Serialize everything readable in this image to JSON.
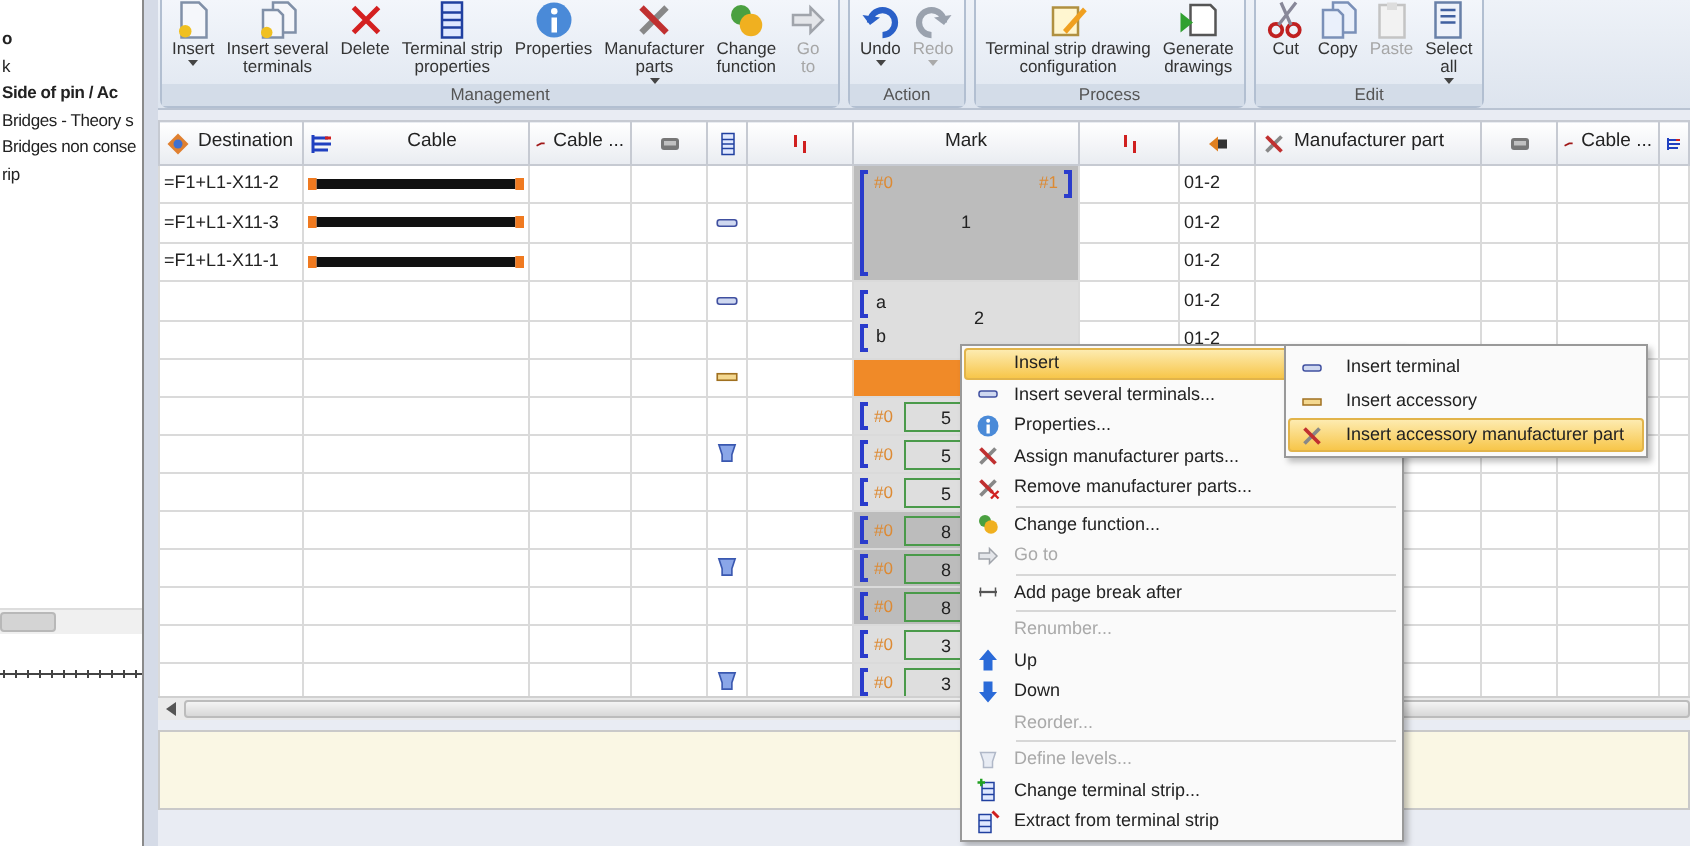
{
  "left_panel": {
    "lines": [
      {
        "text": "o",
        "bold": true
      },
      {
        "text": "k",
        "bold": false
      },
      {
        "text": "Side of pin / Ac",
        "bold": true
      },
      {
        "text": "Bridges - Theory s",
        "bold": false
      },
      {
        "text": "Bridges non conse",
        "bold": false
      },
      {
        "text": "rip",
        "bold": false
      }
    ]
  },
  "ribbon": {
    "groups": [
      {
        "label": "Management",
        "buttons": [
          {
            "label": "Insert",
            "dropdown": true,
            "disabled": false
          },
          {
            "label": "Insert several\nterminals",
            "dropdown": false,
            "disabled": false
          },
          {
            "label": "Delete",
            "dropdown": false,
            "disabled": false
          },
          {
            "label": "Terminal strip\nproperties",
            "dropdown": false,
            "disabled": false
          },
          {
            "label": "Properties",
            "dropdown": false,
            "disabled": false
          },
          {
            "label": "Manufacturer\nparts",
            "dropdown": true,
            "disabled": false
          },
          {
            "label": "Change\nfunction",
            "dropdown": false,
            "disabled": false
          },
          {
            "label": "Go\nto",
            "dropdown": false,
            "disabled": true
          }
        ]
      },
      {
        "label": "Action",
        "buttons": [
          {
            "label": "Undo",
            "dropdown": true,
            "disabled": false
          },
          {
            "label": "Redo",
            "dropdown": true,
            "disabled": true
          }
        ]
      },
      {
        "label": "Process",
        "buttons": [
          {
            "label": "Terminal strip drawing\nconfiguration",
            "dropdown": false,
            "disabled": false
          },
          {
            "label": "Generate\ndrawings",
            "dropdown": false,
            "disabled": false
          }
        ]
      },
      {
        "label": "Edit",
        "buttons": [
          {
            "label": "Cut",
            "dropdown": false,
            "disabled": false
          },
          {
            "label": "Copy",
            "dropdown": false,
            "disabled": false
          },
          {
            "label": "Paste",
            "dropdown": false,
            "disabled": true
          },
          {
            "label": "Select\nall",
            "dropdown": true,
            "disabled": false
          }
        ]
      }
    ]
  },
  "table": {
    "columns": [
      {
        "label": "Destination"
      },
      {
        "label": "Cable"
      },
      {
        "label": "Cable ..."
      },
      {},
      {},
      {},
      {
        "label": "Mark"
      },
      {},
      {},
      {
        "label": "Manufacturer part"
      },
      {},
      {
        "label": "Cable ..."
      },
      {}
    ],
    "rows": [
      {
        "destination": "=F1+L1-X11-2",
        "wire": true,
        "mark": {
          "kind": "group",
          "selected": true,
          "tag_left": "#0",
          "tag_right": "#1",
          "number": "1"
        },
        "column_9": "01-2"
      },
      {
        "destination": "=F1+L1-X11-3",
        "wire": true,
        "marker": {
          "kind": "terminal"
        },
        "column_9": "01-2"
      },
      {
        "destination": "=F1+L1-X11-1",
        "wire": true,
        "column_9": "01-2"
      },
      {
        "marker": {
          "kind": "terminal"
        },
        "mark": {
          "kind": "group",
          "selected": false,
          "subs": [
            "a",
            "b"
          ],
          "number": "2"
        },
        "column_9": "01-2"
      },
      {
        "column_9": "01-2"
      },
      {
        "marker": {
          "kind": "accessory"
        },
        "mark": {
          "kind": "accessory"
        }
      },
      {
        "mark": {
          "kind": "terminal",
          "selected": false,
          "tag_left": "#0",
          "number": "5"
        }
      },
      {
        "marker": {
          "kind": "level"
        },
        "mark": {
          "kind": "terminal",
          "selected": false,
          "tag_left": "#0",
          "number": "5"
        }
      },
      {
        "mark": {
          "kind": "terminal",
          "selected": false,
          "tag_left": "#0",
          "number": "5"
        }
      },
      {
        "mark": {
          "kind": "terminal",
          "selected": true,
          "tag_left": "#0",
          "number": "8"
        }
      },
      {
        "marker": {
          "kind": "level"
        },
        "mark": {
          "kind": "terminal",
          "selected": true,
          "tag_left": "#0",
          "number": "8"
        }
      },
      {
        "mark": {
          "kind": "terminal",
          "selected": true,
          "tag_left": "#0",
          "number": "8"
        }
      },
      {
        "mark": {
          "kind": "terminal",
          "selected": false,
          "tag_left": "#0",
          "number": "3"
        }
      },
      {
        "marker": {
          "kind": "level"
        },
        "mark": {
          "kind": "terminal",
          "selected": false,
          "tag_left": "#0",
          "number": "3"
        }
      }
    ]
  },
  "context_menu": {
    "items": [
      {
        "kind": "item",
        "label": "Insert",
        "selected": true,
        "disabled": false,
        "submenu": true
      },
      {
        "kind": "item",
        "label": "Insert several terminals...",
        "selected": false,
        "disabled": false
      },
      {
        "kind": "item",
        "label": "Properties...",
        "selected": false,
        "disabled": false
      },
      {
        "kind": "item",
        "label": "Assign manufacturer parts...",
        "selected": false,
        "disabled": false
      },
      {
        "kind": "item",
        "label": "Remove manufacturer parts...",
        "selected": false,
        "disabled": false
      },
      {
        "kind": "separator"
      },
      {
        "kind": "item",
        "label": "Change function...",
        "selected": false,
        "disabled": false
      },
      {
        "kind": "item",
        "label": "Go to",
        "selected": false,
        "disabled": true
      },
      {
        "kind": "separator"
      },
      {
        "kind": "item",
        "label": "Add page break after",
        "selected": false,
        "disabled": false
      },
      {
        "kind": "separator"
      },
      {
        "kind": "item",
        "label": "Renumber...",
        "selected": false,
        "disabled": true
      },
      {
        "kind": "item",
        "label": "Up",
        "selected": false,
        "disabled": false
      },
      {
        "kind": "item",
        "label": "Down",
        "selected": false,
        "disabled": false
      },
      {
        "kind": "item",
        "label": "Reorder...",
        "selected": false,
        "disabled": true
      },
      {
        "kind": "separator"
      },
      {
        "kind": "item",
        "label": "Define levels...",
        "selected": false,
        "disabled": true
      },
      {
        "kind": "item",
        "label": "Change terminal strip...",
        "selected": false,
        "disabled": false
      },
      {
        "kind": "item",
        "label": "Extract from terminal strip",
        "selected": false,
        "disabled": false
      }
    ]
  },
  "submenu": {
    "items": [
      {
        "label": "Insert terminal",
        "selected": false
      },
      {
        "label": "Insert accessory",
        "selected": false
      },
      {
        "label": "Insert accessory manufacturer part",
        "selected": true
      }
    ]
  }
}
